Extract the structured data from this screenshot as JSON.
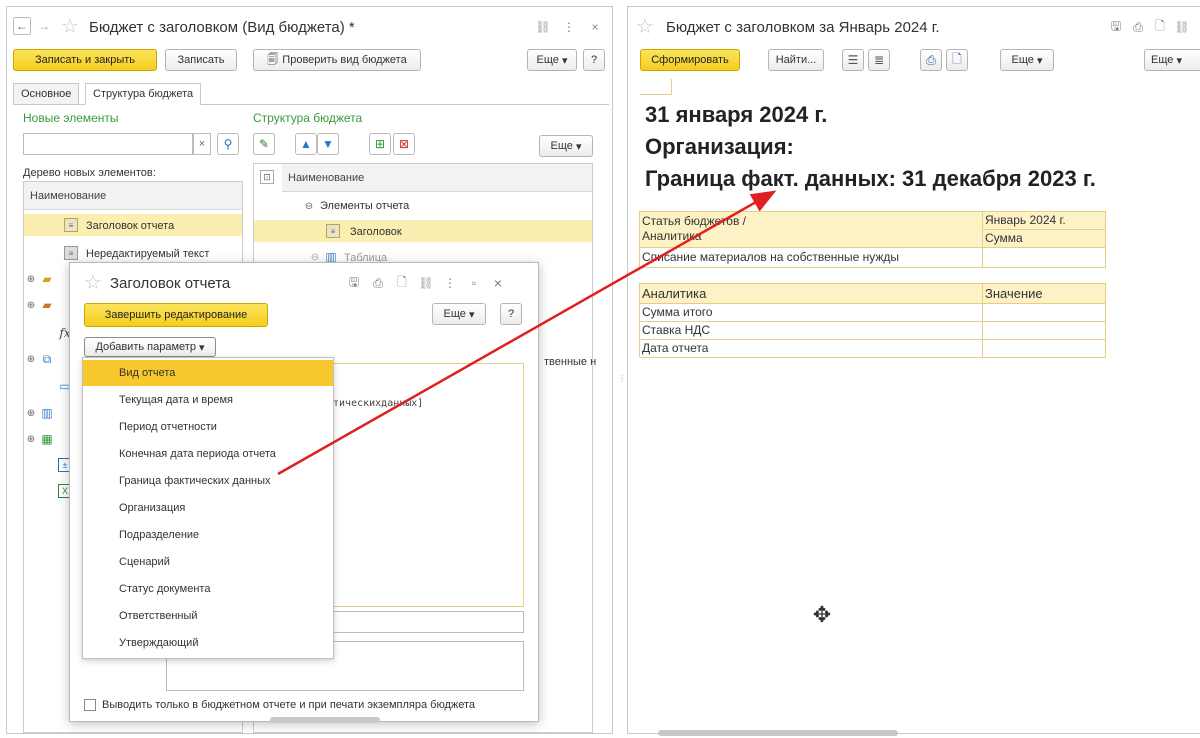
{
  "left_window": {
    "title": "Бюджет с заголовком (Вид бюджета) *",
    "toolbar": {
      "save_close": "Записать и закрыть",
      "save": "Записать",
      "check": "Проверить вид бюджета",
      "more": "Еще",
      "help": "?"
    },
    "tabs": [
      "Основное",
      "Структура бюджета"
    ],
    "new_elements": {
      "title": "Новые элементы",
      "tree_label": "Дерево новых элементов:",
      "column": "Наименование",
      "items": [
        "Заголовок отчета",
        "Нередактируемый текст"
      ]
    },
    "structure": {
      "title": "Структура бюджета",
      "more": "Еще",
      "column": "Наименование",
      "rows": [
        "Элементы отчета",
        "Заголовок",
        "Таблица"
      ],
      "partial_text": "твенные н"
    }
  },
  "dialog": {
    "title": "Заголовок отчета",
    "finish": "Завершить редактирование",
    "more": "Еще",
    "help": "?",
    "add_param": "Добавить параметр",
    "editor_fragment": "ктическихданных]",
    "menu": [
      "Вид отчета",
      "Текущая дата и время",
      "Период отчетности",
      "Конечная дата периода отчета",
      "Граница фактических данных",
      "Организация",
      "Подразделение",
      "Сценарий",
      "Статус документа",
      "Ответственный",
      "Утверждающий"
    ],
    "checkbox_label": "Выводить только в бюджетном отчете и при печати экземпляра бюджета"
  },
  "right_window": {
    "title": "Бюджет с заголовком  за Январь 2024 г.",
    "toolbar": {
      "generate": "Сформировать",
      "find": "Найти...",
      "more": "Еще",
      "more2": "Еще"
    },
    "report": {
      "line1": "31 января 2024 г.",
      "line2": "Организация:",
      "line3": "Граница факт. данных: 31 декабря 2023 г.",
      "table1": {
        "h1a": "Статья бюджетов /",
        "h1b": "Аналитика",
        "h2a": "Январь 2024 г.",
        "h2b": "Сумма",
        "row": "Списание материалов на собственные нужды"
      },
      "table2": {
        "h1": "Аналитика",
        "h2": "Значение",
        "rows": [
          "Сумма итого",
          "Ставка НДС",
          "Дата отчета"
        ]
      }
    }
  },
  "colors": {
    "accent_yellow": "#f4cd1e",
    "green_link": "#3a9a3a",
    "arrow": "#e02020"
  },
  "icons": [
    "back-arrow-icon",
    "forward-arrow-icon",
    "star-icon",
    "link-icon",
    "kebab-icon",
    "close-icon",
    "search-icon",
    "pencil-icon",
    "up-icon",
    "down-icon",
    "save-icon",
    "print-icon",
    "preview-icon",
    "cursor-icon"
  ]
}
